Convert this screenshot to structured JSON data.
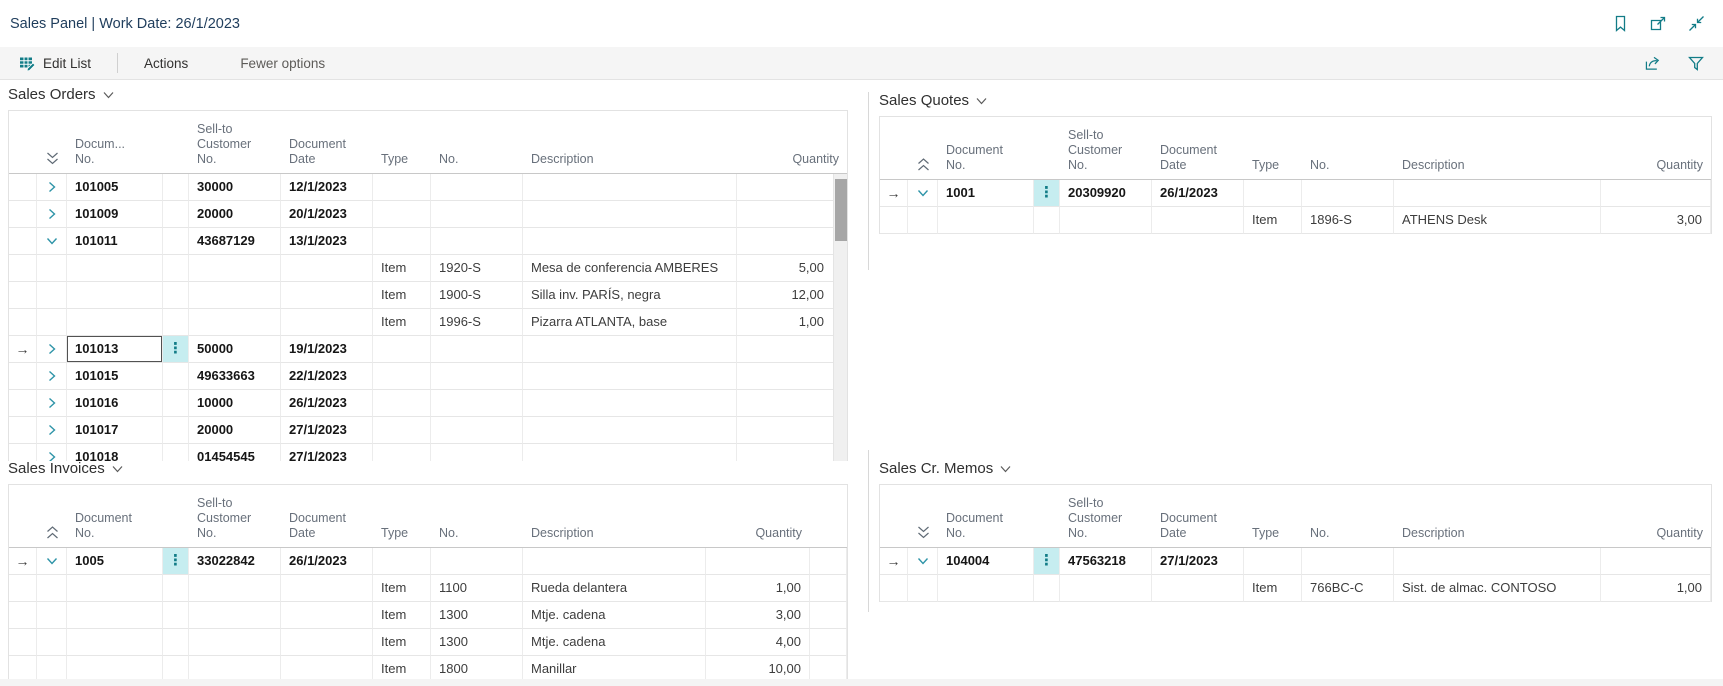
{
  "colors": {
    "accent": "#127c87",
    "selection": "#c6edf0",
    "title": "#1f3d5c"
  },
  "titlebar": {
    "title": "Sales Panel | Work Date: 26/1/2023",
    "icons": [
      {
        "name": "bookmark-icon"
      },
      {
        "name": "popout-icon"
      },
      {
        "name": "collapse-window-icon"
      }
    ]
  },
  "toolbar": {
    "edit_list": "Edit List",
    "actions": "Actions",
    "fewer_options": "Fewer options",
    "icons": [
      {
        "name": "share-icon"
      },
      {
        "name": "filter-icon"
      }
    ]
  },
  "panels": [
    {
      "id": "sales-orders",
      "title": "Sales Orders",
      "collapse_icon": "down",
      "has_scrollbar": true,
      "clip_height": 351,
      "columns": [
        {
          "lines": [
            "Docum...",
            "No."
          ]
        },
        {
          "lines": [
            "Sell-to",
            "Customer",
            "No."
          ]
        },
        {
          "lines": [
            "Document",
            "Date"
          ]
        },
        {
          "lines": [
            "Type"
          ]
        },
        {
          "lines": [
            "No."
          ]
        },
        {
          "lines": [
            "Description"
          ]
        },
        {
          "lines": [
            "Quantity"
          ],
          "align": "right"
        }
      ],
      "rows": [
        {
          "kind": "parent",
          "expand": "collapsed",
          "doc_no": "101005",
          "sell_to": "30000",
          "doc_date": "12/1/2023"
        },
        {
          "kind": "parent",
          "expand": "collapsed",
          "doc_no": "101009",
          "sell_to": "20000",
          "doc_date": "20/1/2023"
        },
        {
          "kind": "parent",
          "expand": "expanded",
          "doc_no": "101011",
          "sell_to": "43687129",
          "doc_date": "13/1/2023"
        },
        {
          "kind": "child",
          "type": "Item",
          "no": "1920-S",
          "description": "Mesa de conferencia AMBERES",
          "quantity": "5,00"
        },
        {
          "kind": "child",
          "type": "Item",
          "no": "1900-S",
          "description": "Silla inv. PARÍS, negra",
          "quantity": "12,00"
        },
        {
          "kind": "child",
          "type": "Item",
          "no": "1996-S",
          "description": "Pizarra ATLANTA, base",
          "quantity": "1,00"
        },
        {
          "kind": "parent",
          "expand": "collapsed",
          "selected": true,
          "focused": true,
          "doc_no": "101013",
          "sell_to": "50000",
          "doc_date": "19/1/2023"
        },
        {
          "kind": "parent",
          "expand": "collapsed",
          "doc_no": "101015",
          "sell_to": "49633663",
          "doc_date": "22/1/2023"
        },
        {
          "kind": "parent",
          "expand": "collapsed",
          "doc_no": "101016",
          "sell_to": "10000",
          "doc_date": "26/1/2023"
        },
        {
          "kind": "parent",
          "expand": "collapsed",
          "doc_no": "101017",
          "sell_to": "20000",
          "doc_date": "27/1/2023"
        },
        {
          "kind": "parent",
          "expand": "collapsed",
          "doc_no": "101018",
          "sell_to": "01454545",
          "doc_date": "27/1/2023"
        }
      ]
    },
    {
      "id": "sales-quotes",
      "title": "Sales Quotes",
      "collapse_icon": "up",
      "columns": [
        {
          "lines": [
            "Document",
            "No."
          ]
        },
        {
          "lines": [
            "Sell-to",
            "Customer",
            "No."
          ]
        },
        {
          "lines": [
            "Document",
            "Date"
          ]
        },
        {
          "lines": [
            "Type"
          ]
        },
        {
          "lines": [
            "No."
          ]
        },
        {
          "lines": [
            "Description"
          ]
        },
        {
          "lines": [
            "Quantity"
          ],
          "align": "right"
        }
      ],
      "rows": [
        {
          "kind": "parent",
          "expand": "expanded",
          "selected": true,
          "doc_no": "1001",
          "sell_to": "20309920",
          "doc_date": "26/1/2023"
        },
        {
          "kind": "child",
          "type": "Item",
          "no": "1896-S",
          "description": "ATHENS Desk",
          "quantity": "3,00"
        }
      ]
    },
    {
      "id": "sales-invoices",
      "title": "Sales Invoices",
      "collapse_icon": "up",
      "trailing_filler": true,
      "columns": [
        {
          "lines": [
            "Document",
            "No."
          ]
        },
        {
          "lines": [
            "Sell-to",
            "Customer",
            "No."
          ]
        },
        {
          "lines": [
            "Document",
            "Date"
          ]
        },
        {
          "lines": [
            "Type"
          ]
        },
        {
          "lines": [
            "No."
          ]
        },
        {
          "lines": [
            "Description"
          ]
        },
        {
          "lines": [
            "Quantity"
          ],
          "align": "right"
        }
      ],
      "rows": [
        {
          "kind": "parent",
          "expand": "expanded",
          "selected": true,
          "doc_no": "1005",
          "sell_to": "33022842",
          "doc_date": "26/1/2023"
        },
        {
          "kind": "child",
          "type": "Item",
          "no": "1100",
          "description": "Rueda delantera",
          "quantity": "1,00"
        },
        {
          "kind": "child",
          "type": "Item",
          "no": "1300",
          "description": "Mtje. cadena",
          "quantity": "3,00"
        },
        {
          "kind": "child",
          "type": "Item",
          "no": "1300",
          "description": "Mtje. cadena",
          "quantity": "4,00"
        },
        {
          "kind": "child",
          "type": "Item",
          "no": "1800",
          "description": "Manillar",
          "quantity": "10,00"
        }
      ]
    },
    {
      "id": "sales-cr-memos",
      "title": "Sales Cr. Memos",
      "collapse_icon": "down",
      "columns": [
        {
          "lines": [
            "Document",
            "No."
          ]
        },
        {
          "lines": [
            "Sell-to",
            "Customer",
            "No."
          ]
        },
        {
          "lines": [
            "Document",
            "Date"
          ]
        },
        {
          "lines": [
            "Type"
          ]
        },
        {
          "lines": [
            "No."
          ]
        },
        {
          "lines": [
            "Description"
          ]
        },
        {
          "lines": [
            "Quantity"
          ],
          "align": "right"
        }
      ],
      "rows": [
        {
          "kind": "parent",
          "expand": "expanded",
          "selected": true,
          "doc_no": "104004",
          "sell_to": "47563218",
          "doc_date": "27/1/2023"
        },
        {
          "kind": "child",
          "type": "Item",
          "no": "766BC-C",
          "description": "Sist. de almac. CONTOSO",
          "quantity": "1,00"
        }
      ]
    }
  ]
}
